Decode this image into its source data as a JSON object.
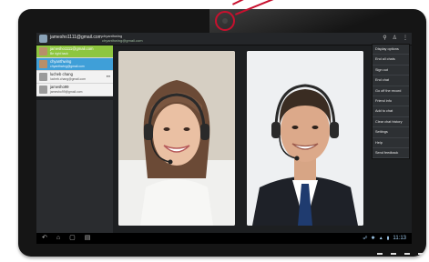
{
  "topbar": {
    "account": "jamesho1111@gmail.com",
    "contact_name": "chyanthwing",
    "contact_status": "chyanthwing@gmail.com"
  },
  "contacts": [
    {
      "name": "jamesho1111@gmail.com",
      "status": "Be right back",
      "tag": ""
    },
    {
      "name": "chyanthwing",
      "status": "chyanthwing@gmail.com",
      "tag": ""
    },
    {
      "name": "lucheb chang",
      "status": "lucheb.chang@gmail.com",
      "tag": "●●"
    },
    {
      "name": "jamesho99",
      "status": "jamesho99@gmail.com",
      "tag": ""
    }
  ],
  "menu": [
    "Display options",
    "End all chats",
    "Sign out",
    "End chat",
    "Go off the record",
    "Friend info",
    "Add to chat",
    "Clear chat history",
    "Settings",
    "Help",
    "Send feedback"
  ],
  "status_bar": {
    "time": "11:13"
  },
  "icons": {
    "app": "talk-app-icon",
    "search": "search-icon",
    "add": "add-friend-icon",
    "overflow": "overflow-menu-icon",
    "back": "back-icon",
    "home": "home-icon",
    "recents": "recents-icon",
    "menu": "menu-icon"
  },
  "colors": {
    "selected_contact": "#8ec63f",
    "active_chat": "#3f9fd8",
    "camera_highlight": "#c8102e",
    "status_text": "#9ec8ea"
  }
}
